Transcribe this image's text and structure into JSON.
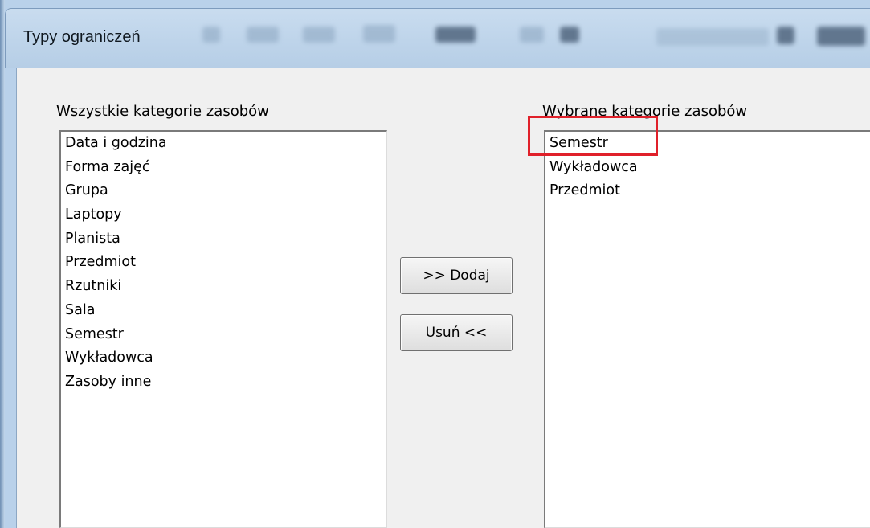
{
  "window": {
    "title": "Typy ograniczeń"
  },
  "available": {
    "label": "Wszystkie kategorie zasobów",
    "items": [
      "Data i godzina",
      "Forma zajęć",
      "Grupa",
      "Laptopy",
      "Planista",
      "Przedmiot",
      "Rzutniki",
      "Sala",
      "Semestr",
      "Wykładowca",
      "Zasoby inne"
    ]
  },
  "selected": {
    "label": "Wybrane kategorie zasobów",
    "items": [
      "Semestr",
      "Wykładowca",
      "Przedmiot"
    ]
  },
  "buttons": {
    "add_label": ">> Dodaj",
    "remove_label": "Usuń <<"
  },
  "annotation": {
    "highlight_color": "#e0202a"
  }
}
